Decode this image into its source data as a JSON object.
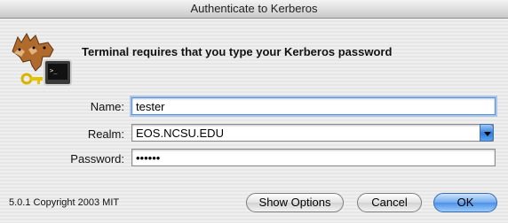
{
  "window": {
    "title": "Authenticate to Kerberos"
  },
  "message": "Terminal requires that you type your Kerberos password",
  "form": {
    "name_label": "Name:",
    "name_value": "tester",
    "realm_label": "Realm:",
    "realm_value": "EOS.NCSU.EDU",
    "password_label": "Password:",
    "password_value": "••••••"
  },
  "footer": {
    "copyright": "5.0.1 Copyright 2003 MIT"
  },
  "buttons": {
    "show_options": "Show Options",
    "cancel": "Cancel",
    "ok": "OK"
  },
  "icons": {
    "app": "kerberos-cerberus-icon",
    "terminal": "terminal-icon",
    "key": "key-icon"
  },
  "colors": {
    "accent": "#4d90e6",
    "focus_ring": "#a9c6ef"
  }
}
